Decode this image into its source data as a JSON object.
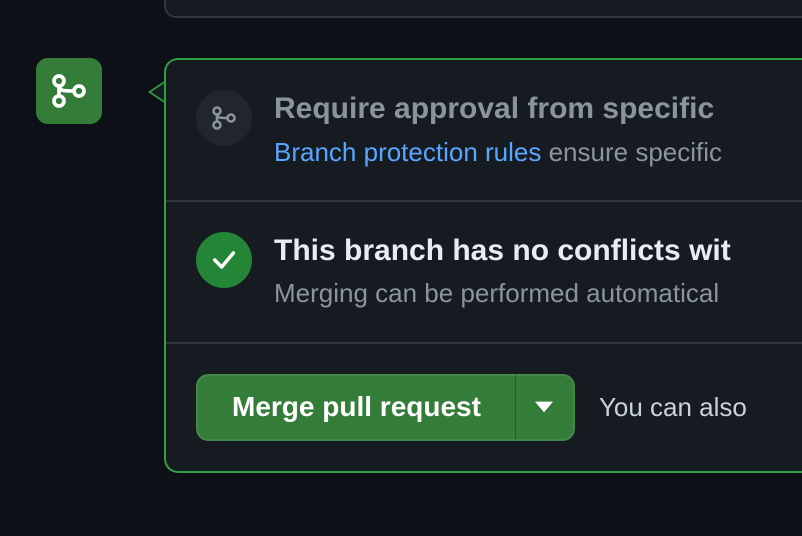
{
  "colors": {
    "accent_green": "#347d39",
    "success_green": "#238636",
    "border_green": "#2ea043",
    "link_blue": "#58a6ff",
    "muted": "#8b949e",
    "text": "#e6edf3"
  },
  "left_badge_icon": "git-merge-icon",
  "panel": {
    "sections": [
      {
        "icon": "git-merge-icon",
        "status": "neutral",
        "title": "Require approval from specific",
        "link_text": "Branch protection rules",
        "sub_rest": " ensure specific"
      },
      {
        "icon": "check-icon",
        "status": "success",
        "title": "This branch has no conflicts wit",
        "sub": "Merging can be performed automatical"
      }
    ],
    "merge": {
      "button_label": "Merge pull request",
      "hint": "You can also"
    }
  }
}
